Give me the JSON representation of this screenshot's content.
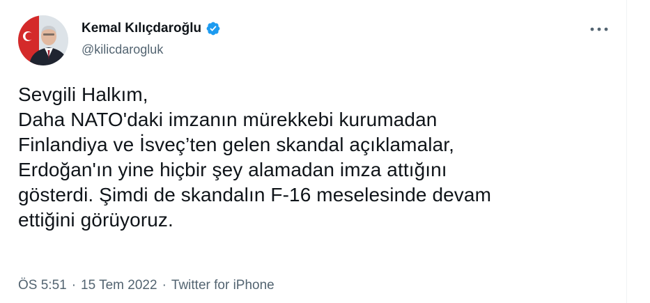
{
  "author": {
    "display_name": "Kemal Kılıçdaroğlu",
    "handle": "@kilicdarogluk",
    "verified_color": "#1d9bf0"
  },
  "tweet": {
    "lines": [
      "Sevgili Halkım,",
      "Daha NATO'daki imzanın mürekkebi kurumadan",
      "Finlandiya ve İsveç’ten gelen skandal açıklamalar,",
      "Erdoğan'ın yine hiçbir şey alamadan imza attığını",
      "gösterdi. Şimdi de skandalın F-16 meselesinde devam",
      "ettiğini görüyoruz."
    ]
  },
  "meta": {
    "time": "ÖS 5:51",
    "separator": "·",
    "date": "15 Tem 2022",
    "source": "Twitter for iPhone"
  },
  "icons": {
    "more": "more-horizontal-icon",
    "verified": "verified-badge-icon"
  }
}
